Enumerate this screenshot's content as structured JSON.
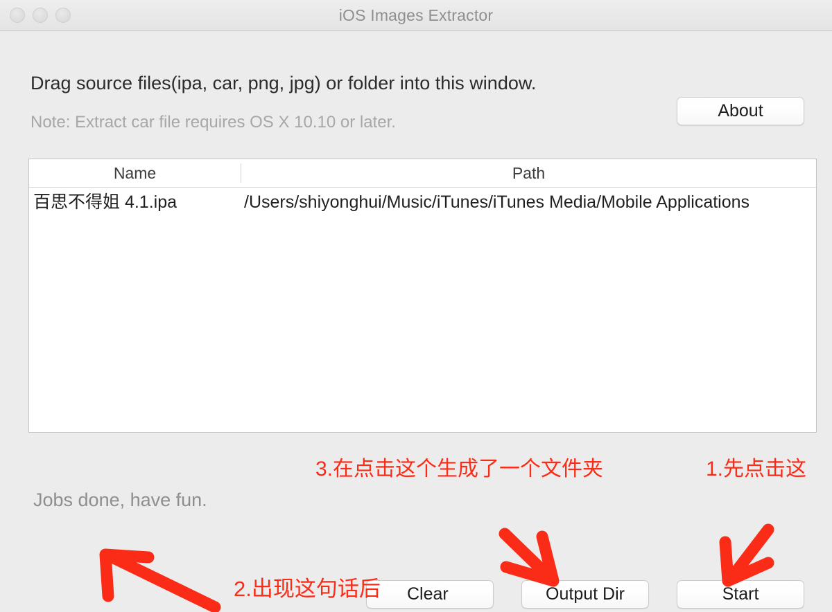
{
  "window": {
    "title": "iOS Images Extractor",
    "traffic_lights": [
      "close-button",
      "minimize-button",
      "zoom-button"
    ]
  },
  "header": {
    "drag_hint": "Drag source files(ipa, car, png, jpg) or folder into this window.",
    "note": "Note: Extract car file requires OS X 10.10 or later.",
    "about_label": "About"
  },
  "table": {
    "columns": [
      "Name",
      "Path"
    ],
    "rows": [
      {
        "name": "百思不得姐 4.1.ipa",
        "path": "/Users/shiyonghui/Music/iTunes/iTunes Media/Mobile Applications"
      }
    ]
  },
  "footer": {
    "status": "Jobs done, have fun.",
    "clear_label": "Clear",
    "output_dir_label": "Output Dir",
    "start_label": "Start"
  },
  "annotations": {
    "step1": "1.先点击这",
    "step2": "2.出现这句话后",
    "step3": "3.在点击这个生成了一个文件夹",
    "color": "#fa2b17"
  }
}
